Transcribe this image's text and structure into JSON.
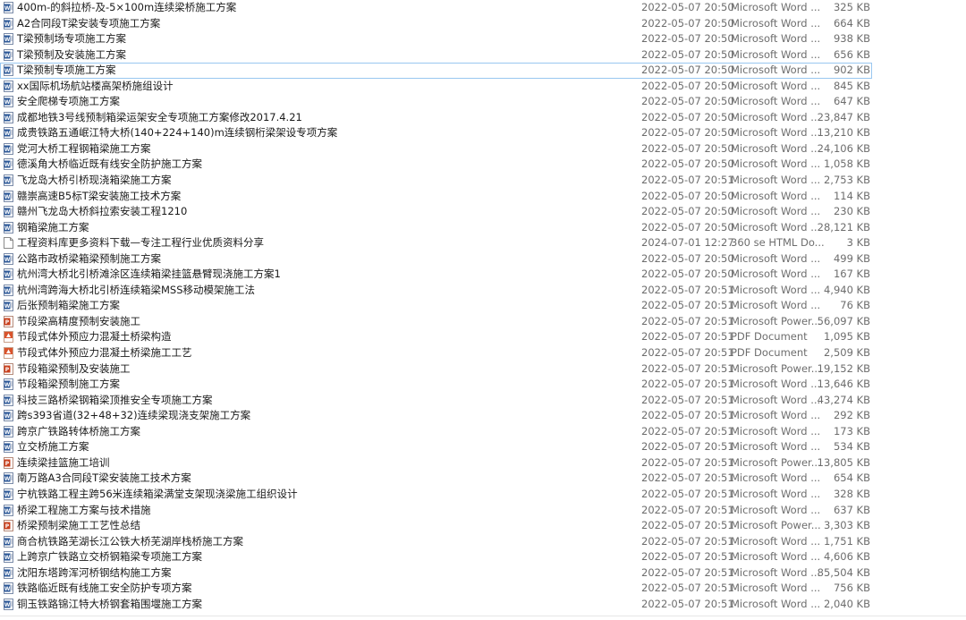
{
  "files": [
    {
      "name": "400m-的斜拉桥-及-5×100m连续梁桥施工方案",
      "date": "2022-05-07 20:50",
      "type": "Microsoft Word ...",
      "size": "325 KB",
      "icon": "word-icon"
    },
    {
      "name": "A2合同段T梁安装专项施工方案",
      "date": "2022-05-07 20:50",
      "type": "Microsoft Word ...",
      "size": "664 KB",
      "icon": "word-icon"
    },
    {
      "name": "T梁预制场专项施工方案",
      "date": "2022-05-07 20:50",
      "type": "Microsoft Word ...",
      "size": "938 KB",
      "icon": "word-icon"
    },
    {
      "name": "T梁预制及安装施工方案",
      "date": "2022-05-07 20:50",
      "type": "Microsoft Word ...",
      "size": "656 KB",
      "icon": "word-icon"
    },
    {
      "name": "T梁预制专项施工方案",
      "date": "2022-05-07 20:50",
      "type": "Microsoft Word ...",
      "size": "902 KB",
      "icon": "word-icon",
      "selected": true
    },
    {
      "name": "xx国际机场航站楼高架桥施组设计",
      "date": "2022-05-07 20:50",
      "type": "Microsoft Word ...",
      "size": "845 KB",
      "icon": "word-icon"
    },
    {
      "name": "安全爬梯专项施工方案",
      "date": "2022-05-07 20:50",
      "type": "Microsoft Word ...",
      "size": "647 KB",
      "icon": "word-icon"
    },
    {
      "name": "成都地铁3号线预制箱梁运架安全专项施工方案修改2017.4.21",
      "date": "2022-05-07 20:50",
      "type": "Microsoft Word ...",
      "size": "23,847 KB",
      "icon": "word-icon"
    },
    {
      "name": "成贵铁路五通岷江特大桥(140+224+140)m连续钢桁梁架设专项方案",
      "date": "2022-05-07 20:50",
      "type": "Microsoft Word ...",
      "size": "13,210 KB",
      "icon": "word-icon"
    },
    {
      "name": "党河大桥工程钢箱梁施工方案",
      "date": "2022-05-07 20:50",
      "type": "Microsoft Word ...",
      "size": "24,106 KB",
      "icon": "word-icon"
    },
    {
      "name": "德溪角大桥临近既有线安全防护施工方案",
      "date": "2022-05-07 20:50",
      "type": "Microsoft Word ...",
      "size": "1,058 KB",
      "icon": "word-icon"
    },
    {
      "name": "飞龙岛大桥引桥现浇箱梁施工方案",
      "date": "2022-05-07 20:51",
      "type": "Microsoft Word ...",
      "size": "2,753 KB",
      "icon": "word-icon"
    },
    {
      "name": "赣崇高速B5标T梁安装施工技术方案",
      "date": "2022-05-07 20:50",
      "type": "Microsoft Word ...",
      "size": "114 KB",
      "icon": "word-icon"
    },
    {
      "name": "赣州飞龙岛大桥斜拉索安装工程1210",
      "date": "2022-05-07 20:50",
      "type": "Microsoft Word ...",
      "size": "230 KB",
      "icon": "word-icon"
    },
    {
      "name": "钢箱梁施工方案",
      "date": "2022-05-07 20:50",
      "type": "Microsoft Word ...",
      "size": "28,121 KB",
      "icon": "word-icon"
    },
    {
      "name": "工程资料库更多资料下载—专注工程行业优质资料分享",
      "date": "2024-07-01 12:27",
      "type": "360 se HTML Do...",
      "size": "3 KB",
      "icon": "html-icon"
    },
    {
      "name": "公路市政桥梁箱梁预制施工方案",
      "date": "2022-05-07 20:50",
      "type": "Microsoft Word ...",
      "size": "499 KB",
      "icon": "word-icon"
    },
    {
      "name": "杭州湾大桥北引桥滩涂区连续箱梁挂篮悬臂现浇施工方案1",
      "date": "2022-05-07 20:50",
      "type": "Microsoft Word ...",
      "size": "167 KB",
      "icon": "word-icon"
    },
    {
      "name": "杭州湾跨海大桥北引桥连续箱梁MSS移动模架施工法",
      "date": "2022-05-07 20:51",
      "type": "Microsoft Word ...",
      "size": "4,940 KB",
      "icon": "word-icon"
    },
    {
      "name": "后张预制箱梁施工方案",
      "date": "2022-05-07 20:51",
      "type": "Microsoft Word ...",
      "size": "76 KB",
      "icon": "word-icon"
    },
    {
      "name": "节段梁高精度预制安装施工",
      "date": "2022-05-07 20:51",
      "type": "Microsoft Power...",
      "size": "56,097 KB",
      "icon": "powerpoint-icon"
    },
    {
      "name": "节段式体外预应力混凝土桥梁构造",
      "date": "2022-05-07 20:51",
      "type": "PDF Document",
      "size": "1,095 KB",
      "icon": "pdf-icon"
    },
    {
      "name": "节段式体外预应力混凝土桥梁施工工艺",
      "date": "2022-05-07 20:51",
      "type": "PDF Document",
      "size": "2,509 KB",
      "icon": "pdf-icon"
    },
    {
      "name": "节段箱梁预制及安装施工",
      "date": "2022-05-07 20:51",
      "type": "Microsoft Power...",
      "size": "19,152 KB",
      "icon": "powerpoint-icon"
    },
    {
      "name": "节段箱梁预制施工方案",
      "date": "2022-05-07 20:51",
      "type": "Microsoft Word ...",
      "size": "13,646 KB",
      "icon": "word-icon"
    },
    {
      "name": "科技三路桥梁钢箱梁顶推安全专项施工方案",
      "date": "2022-05-07 20:51",
      "type": "Microsoft Word ...",
      "size": "43,274 KB",
      "icon": "word-icon"
    },
    {
      "name": "跨s393省道(32+48+32)连续梁现浇支架施工方案",
      "date": "2022-05-07 20:51",
      "type": "Microsoft Word ...",
      "size": "292 KB",
      "icon": "word-icon"
    },
    {
      "name": "跨京广铁路转体桥施工方案",
      "date": "2022-05-07 20:51",
      "type": "Microsoft Word ...",
      "size": "173 KB",
      "icon": "word-icon"
    },
    {
      "name": "立交桥施工方案",
      "date": "2022-05-07 20:51",
      "type": "Microsoft Word ...",
      "size": "534 KB",
      "icon": "word-icon"
    },
    {
      "name": "连续梁挂篮施工培训",
      "date": "2022-05-07 20:51",
      "type": "Microsoft Power...",
      "size": "13,805 KB",
      "icon": "powerpoint-icon"
    },
    {
      "name": "南万路A3合同段T梁安装施工技术方案",
      "date": "2022-05-07 20:51",
      "type": "Microsoft Word ...",
      "size": "654 KB",
      "icon": "word-icon"
    },
    {
      "name": "宁杭铁路工程主跨56米连续箱梁满堂支架现浇梁施工组织设计",
      "date": "2022-05-07 20:51",
      "type": "Microsoft Word ...",
      "size": "328 KB",
      "icon": "word-icon"
    },
    {
      "name": "桥梁工程施工方案与技术措施",
      "date": "2022-05-07 20:51",
      "type": "Microsoft Word ...",
      "size": "637 KB",
      "icon": "word-icon"
    },
    {
      "name": "桥梁预制梁施工工艺性总结",
      "date": "2022-05-07 20:51",
      "type": "Microsoft Power...",
      "size": "3,303 KB",
      "icon": "powerpoint-icon"
    },
    {
      "name": "商合杭铁路芜湖长江公铁大桥芜湖岸栈桥施工方案",
      "date": "2022-05-07 20:51",
      "type": "Microsoft Word ...",
      "size": "1,751 KB",
      "icon": "word-icon"
    },
    {
      "name": "上跨京广铁路立交桥钢箱梁专项施工方案",
      "date": "2022-05-07 20:51",
      "type": "Microsoft Word ...",
      "size": "4,606 KB",
      "icon": "word-icon"
    },
    {
      "name": "沈阳东塔跨浑河桥钢结构施工方案",
      "date": "2022-05-07 20:51",
      "type": "Microsoft Word ...",
      "size": "85,504 KB",
      "icon": "word-icon"
    },
    {
      "name": "铁路临近既有线施工安全防护专项方案",
      "date": "2022-05-07 20:51",
      "type": "Microsoft Word ...",
      "size": "756 KB",
      "icon": "word-icon"
    },
    {
      "name": "铜玉铁路锦江特大桥钢套箱围堰施工方案",
      "date": "2022-05-07 20:51",
      "type": "Microsoft Word ...",
      "size": "2,040 KB",
      "icon": "word-icon"
    }
  ],
  "colors": {
    "word": "#2b5797",
    "powerpoint": "#c8401e",
    "pdf": "#d9532c",
    "html": "#8a8a8a",
    "selection_border": "#99c7f0"
  }
}
